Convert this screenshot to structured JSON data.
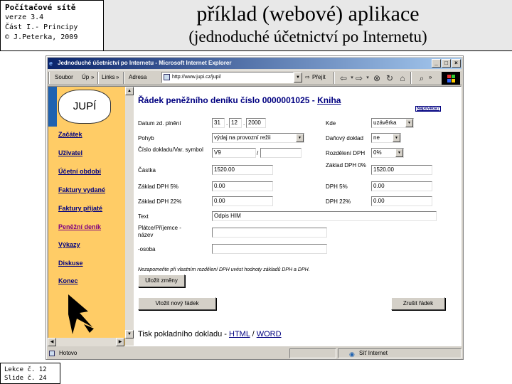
{
  "slide": {
    "course": "Počítačové sítě",
    "version": "verze 3.4",
    "part": "Část I.- Principy",
    "author": "© J.Peterka, 2009",
    "title": "příklad (webové) aplikace",
    "subtitle": "(jednoduché účetnictví po Internetu)",
    "lecture": "Lekce č. 12",
    "slide_no": "Slide č. 24"
  },
  "window": {
    "title": "Jednoduché účetnictví po Internetu - Microsoft Internet Explorer",
    "min_label": "_",
    "max_label": "□",
    "close_label": "×"
  },
  "toolbar": {
    "soubor": "Soubor",
    "upravy": "Úp",
    "links": "Links",
    "address_label": "Adresa",
    "address_value": "http://www.jupi.cz/jupi/",
    "go_label": "Přejít"
  },
  "sidebar": {
    "logo": "JUPÍ",
    "items": [
      {
        "label": "Začátek"
      },
      {
        "label": "Uživatel"
      },
      {
        "label": "Účetní období"
      },
      {
        "label": "Faktury vydané"
      },
      {
        "label": "Faktury přijaté"
      },
      {
        "label": "Peněžní deník"
      },
      {
        "label": "Výkazy"
      },
      {
        "label": "Diskuse"
      },
      {
        "label": "Konec"
      }
    ]
  },
  "form": {
    "heading": "Řádek peněžního deníku číslo 0000001025 - ",
    "heading_link": "Kniha",
    "help": "Nápověda?",
    "date_label": "Datum zd. plnění",
    "date_day": "31",
    "date_month": "12",
    "date_year": "2000",
    "kde_label": "Kde",
    "kde_value": "uzávěrka",
    "pohyb_label": "Pohyb",
    "pohyb_value": "výdaj na provozní režii",
    "danovy_label": "Daňový doklad",
    "danovy_value": "ne",
    "cislo_label": "Číslo dokladu/Var. symbol",
    "cislo_value": "V9",
    "cislo_value2": "",
    "rozdeleni_label": "Rozdělení DPH",
    "rozdeleni_value": "0%",
    "castka_label": "Částka",
    "castka_value": "1520.00",
    "zaklad0_label": "Základ DPH 0%",
    "zaklad0_value": "1520.00",
    "zaklad5_label": "Základ DPH 5%",
    "zaklad5_value": "0.00",
    "dph5_label": "DPH 5%",
    "dph5_value": "0.00",
    "zaklad22_label": "Základ DPH 22%",
    "zaklad22_value": "0.00",
    "dph22_label": "DPH 22%",
    "dph22_value": "0.00",
    "text_label": "Text",
    "text_value": "Odpis HIM",
    "platce_label": "Plátce/Příjemce -název",
    "platce_value": "",
    "osoba_label": "-osoba",
    "osoba_value": "",
    "note": "Nezapomeňte při vlastním rozdělení DPH uvést hodnoty základů DPH a DPH.",
    "save_button": "Uložit změny",
    "new_row_button": "Vložit nový řádek",
    "cancel_button": "Zrušit řádek",
    "print_text": "Tisk pokladního dokladu - ",
    "print_html": "HTML",
    "print_sep": " / ",
    "print_word": "WORD"
  },
  "status": {
    "left": "Hotovo",
    "zone": "Síť Internet"
  }
}
